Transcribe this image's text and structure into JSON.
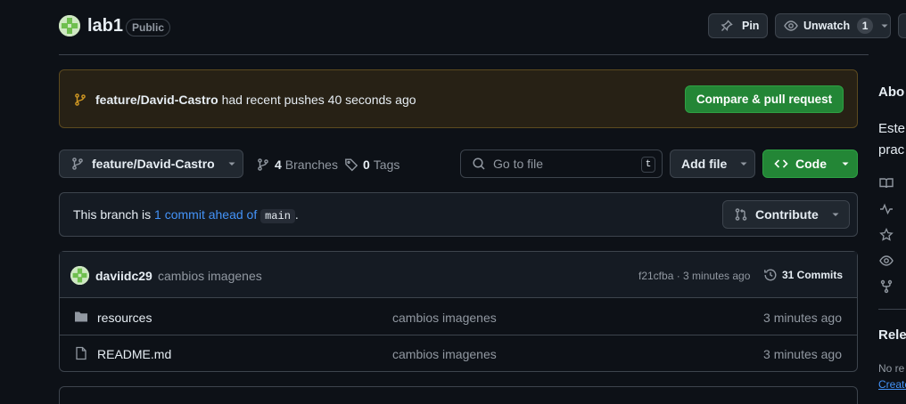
{
  "header": {
    "repo_name": "lab1",
    "visibility": "Public",
    "pin_label": "Pin",
    "watch_label": "Unwatch",
    "watch_count": "1"
  },
  "banner": {
    "branch": "feature/David-Castro",
    "text": " had recent pushes 40 seconds ago",
    "compare_label": "Compare & pull request"
  },
  "toolbar": {
    "branch_label": "feature/David-Castro",
    "branches_count": "4",
    "branches_label": "Branches",
    "tags_count": "0",
    "tags_label": "Tags",
    "goto_placeholder": "Go to file",
    "goto_shortcut": "t",
    "add_file_label": "Add file",
    "code_label": "Code"
  },
  "ahead": {
    "prefix": "This branch is ",
    "link": "1 commit ahead of",
    "base": "main",
    "suffix": ".",
    "contribute_label": "Contribute"
  },
  "latest_commit": {
    "user": "daviidc29",
    "message": "cambios imagenes",
    "sha_time": "f21cfba · 3 minutes ago",
    "commits_label": "31 Commits"
  },
  "files": [
    {
      "name": "resources",
      "type": "folder",
      "message": "cambios imagenes",
      "age": "3 minutes ago"
    },
    {
      "name": "README.md",
      "type": "file",
      "message": "cambios imagenes",
      "age": "3 minutes ago"
    }
  ],
  "sidebar": {
    "about_heading": "Abo",
    "description_l1": "Este",
    "description_l2": "prac",
    "releases_heading": "Rele",
    "no_releases": "No re",
    "create_link": "Create"
  }
}
